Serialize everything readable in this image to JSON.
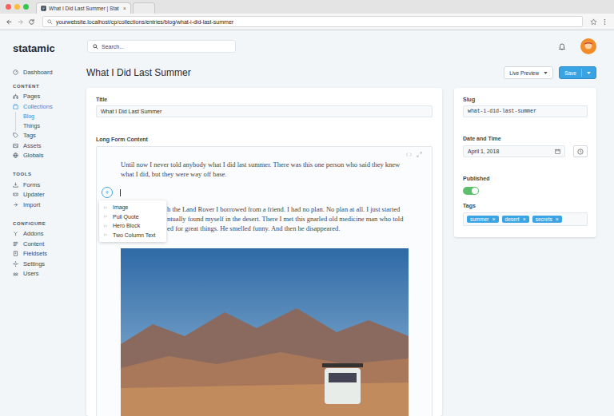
{
  "browser": {
    "tab_title": "What I Did Last Summer | Stat",
    "tab_close": "×",
    "url": "yourwebsite.localhost/cp/collections/entries/blog/what-i-did-last-summer"
  },
  "app": {
    "logo": "statamic",
    "search_placeholder": "Search..."
  },
  "sidebar": {
    "sections": [
      {
        "items": [
          {
            "label": "Dashboard",
            "selected": false,
            "children": []
          }
        ]
      },
      {
        "heading": "CONTENT",
        "items": [
          {
            "label": "Pages",
            "selected": false,
            "children": []
          },
          {
            "label": "Collections",
            "selected": true,
            "children": [
              {
                "label": "Blog",
                "selected": true
              },
              {
                "label": "Things",
                "selected": false
              }
            ]
          },
          {
            "label": "Tags",
            "selected": false,
            "children": []
          },
          {
            "label": "Assets",
            "selected": false,
            "children": []
          },
          {
            "label": "Globals",
            "selected": false,
            "children": []
          }
        ]
      },
      {
        "heading": "TOOLS",
        "items": [
          {
            "label": "Forms",
            "selected": false,
            "children": []
          },
          {
            "label": "Updater",
            "selected": false,
            "children": []
          },
          {
            "label": "Import",
            "selected": false,
            "children": []
          }
        ]
      },
      {
        "heading": "CONFIGURE",
        "items": [
          {
            "label": "Addons",
            "selected": false,
            "children": []
          },
          {
            "label": "Content",
            "selected": false,
            "children": []
          },
          {
            "label": "Fieldsets",
            "selected": false,
            "children": []
          },
          {
            "label": "Settings",
            "selected": false,
            "children": []
          },
          {
            "label": "Users",
            "selected": false,
            "children": []
          }
        ]
      }
    ]
  },
  "page": {
    "title": "What I Did Last Summer",
    "live_preview": "Live Preview",
    "save": "Save"
  },
  "main": {
    "title_field": {
      "label": "Title",
      "value": "What I Did Last Summer"
    },
    "content_field": {
      "label": "Long Form Content",
      "paragraph_1": [
        "Until now I never told anybody what I did last summer. There was this one person who said they knew",
        "what I did, but they were way off base."
      ],
      "insert_button": "+",
      "insert_menu": {
        "expanded": true,
        "items": [
          "Image",
          "Pull Quote",
          "Hero Block",
          "Two Column Text"
        ]
      },
      "paragraph_2_visible": [
        "h the Land Rover I borrowed from a friend. I had no plan. No plan at all. I just started",
        "ntually found myself in the desert. There I met this gnarled old medicine man who told",
        "ed for great things. He smelled funny. And then he disappeared."
      ]
    }
  },
  "meta": {
    "slug": {
      "label": "Slug",
      "value": "what-i-did-last-summer"
    },
    "date": {
      "label": "Date and Time",
      "value": "April 1, 2018"
    },
    "published": {
      "label": "Published",
      "on": true
    },
    "tags": {
      "label": "Tags",
      "remove_glyph": "×",
      "items": [
        {
          "label": "summer",
          "color": "#3aa3e3"
        },
        {
          "label": "desert",
          "color": "#3aa3e3"
        },
        {
          "label": "secrets",
          "color": "#3aa3e3"
        }
      ]
    }
  }
}
